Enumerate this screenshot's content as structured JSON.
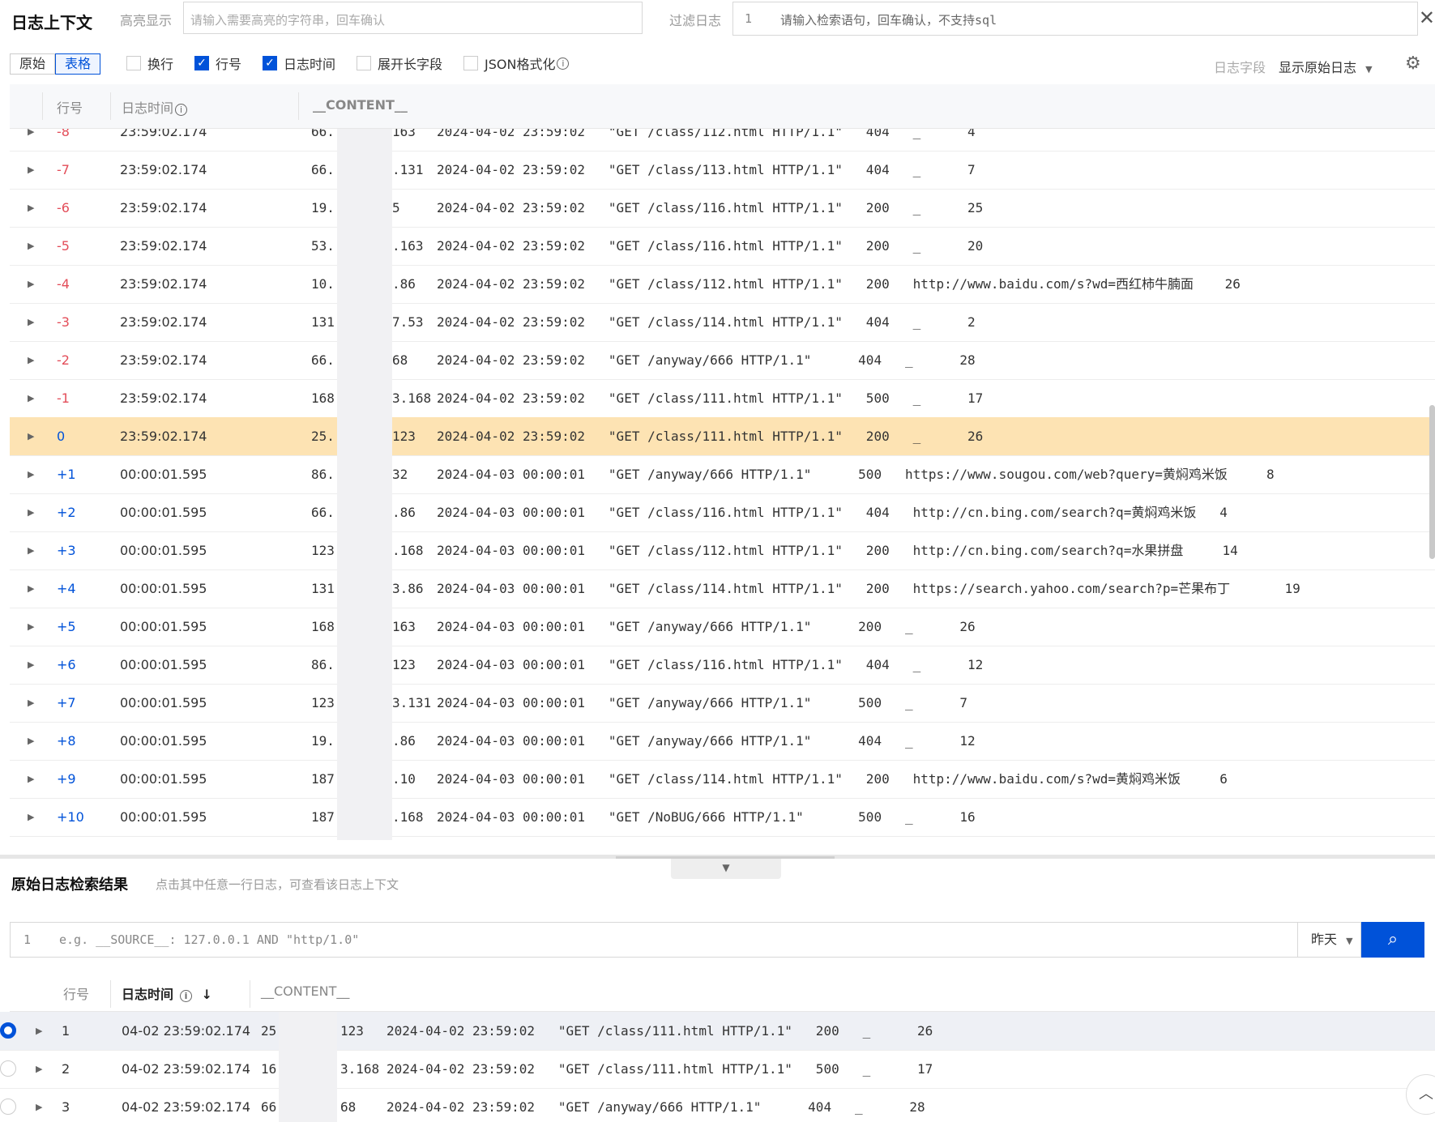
{
  "header": {
    "title": "日志上下文",
    "highlight_label": "高亮显示",
    "highlight_placeholder": "请输入需要高亮的字符串，回车确认",
    "filter_label": "过滤日志",
    "filter_line_no": "1",
    "filter_placeholder": "请输入检索语句，回车确认，不支持sql",
    "close_icon": "close-icon"
  },
  "toolbar": {
    "view_raw": "原始",
    "view_table": "表格",
    "options": [
      {
        "label": "换行",
        "checked": false
      },
      {
        "label": "行号",
        "checked": true
      },
      {
        "label": "日志时间",
        "checked": true
      },
      {
        "label": "展开长字段",
        "checked": false
      },
      {
        "label": "JSON格式化",
        "checked": false
      }
    ],
    "field_label": "日志字段",
    "field_value": "显示原始日志",
    "settings_icon": "gear-icon"
  },
  "context_table": {
    "columns": [
      "行号",
      "日志时间",
      "__CONTENT__"
    ],
    "highlight_color": "#fde3b3",
    "rows": [
      {
        "no": "-8",
        "time": "23:59:02.174",
        "ip_a": "66.",
        "ip_b": "163",
        "content": "2024-04-02 23:59:02   \"GET /class/112.html HTTP/1.1\"   404   _      4"
      },
      {
        "no": "-7",
        "time": "23:59:02.174",
        "ip_a": "66.",
        "ip_b": ".131",
        "content": "2024-04-02 23:59:02   \"GET /class/113.html HTTP/1.1\"   404   _      7"
      },
      {
        "no": "-6",
        "time": "23:59:02.174",
        "ip_a": "19.",
        "ip_b": "5",
        "content": "2024-04-02 23:59:02   \"GET /class/116.html HTTP/1.1\"   200   _      25"
      },
      {
        "no": "-5",
        "time": "23:59:02.174",
        "ip_a": "53.",
        "ip_b": ".163",
        "content": "2024-04-02 23:59:02   \"GET /class/116.html HTTP/1.1\"   200   _      20"
      },
      {
        "no": "-4",
        "time": "23:59:02.174",
        "ip_a": "10.",
        "ip_b": ".86",
        "content": "2024-04-02 23:59:02   \"GET /class/112.html HTTP/1.1\"   200   http://www.baidu.com/s?wd=西红柿牛腩面    26"
      },
      {
        "no": "-3",
        "time": "23:59:02.174",
        "ip_a": "131",
        "ip_b": "7.53",
        "content": "2024-04-02 23:59:02   \"GET /class/114.html HTTP/1.1\"   404   _      2"
      },
      {
        "no": "-2",
        "time": "23:59:02.174",
        "ip_a": "66.",
        "ip_b": "68",
        "content": "2024-04-02 23:59:02   \"GET /anyway/666 HTTP/1.1\"      404   _      28"
      },
      {
        "no": "-1",
        "time": "23:59:02.174",
        "ip_a": "168",
        "ip_b": "3.168",
        "content": "2024-04-02 23:59:02   \"GET /class/111.html HTTP/1.1\"   500   _      17"
      },
      {
        "no": "0",
        "time": "23:59:02.174",
        "ip_a": "25.",
        "ip_b": "123",
        "content": "2024-04-02 23:59:02   \"GET /class/111.html HTTP/1.1\"   200   _      26",
        "highlight": true
      },
      {
        "no": "+1",
        "time": "00:00:01.595",
        "ip_a": "86.",
        "ip_b": "32",
        "content": "2024-04-03 00:00:01   \"GET /anyway/666 HTTP/1.1\"      500   https://www.sougou.com/web?query=黄焖鸡米饭     8"
      },
      {
        "no": "+2",
        "time": "00:00:01.595",
        "ip_a": "66.",
        "ip_b": ".86",
        "content": "2024-04-03 00:00:01   \"GET /class/116.html HTTP/1.1\"   404   http://cn.bing.com/search?q=黄焖鸡米饭   4"
      },
      {
        "no": "+3",
        "time": "00:00:01.595",
        "ip_a": "123",
        "ip_b": ".168",
        "content": "2024-04-03 00:00:01   \"GET /class/112.html HTTP/1.1\"   200   http://cn.bing.com/search?q=水果拼盘     14"
      },
      {
        "no": "+4",
        "time": "00:00:01.595",
        "ip_a": "131",
        "ip_b": "3.86",
        "content": "2024-04-03 00:00:01   \"GET /class/114.html HTTP/1.1\"   200   https://search.yahoo.com/search?p=芒果布丁       19"
      },
      {
        "no": "+5",
        "time": "00:00:01.595",
        "ip_a": "168",
        "ip_b": "163",
        "content": "2024-04-03 00:00:01   \"GET /anyway/666 HTTP/1.1\"      200   _      26"
      },
      {
        "no": "+6",
        "time": "00:00:01.595",
        "ip_a": "86.",
        "ip_b": "123",
        "content": "2024-04-03 00:00:01   \"GET /class/116.html HTTP/1.1\"   404   _      12"
      },
      {
        "no": "+7",
        "time": "00:00:01.595",
        "ip_a": "123",
        "ip_b": "3.131",
        "content": "2024-04-03 00:00:01   \"GET /anyway/666 HTTP/1.1\"      500   _      7"
      },
      {
        "no": "+8",
        "time": "00:00:01.595",
        "ip_a": "19.",
        "ip_b": ".86",
        "content": "2024-04-03 00:00:01   \"GET /anyway/666 HTTP/1.1\"      404   _      12"
      },
      {
        "no": "+9",
        "time": "00:00:01.595",
        "ip_a": "187",
        "ip_b": ".10",
        "content": "2024-04-03 00:00:01   \"GET /class/114.html HTTP/1.1\"   200   http://www.baidu.com/s?wd=黄焖鸡米饭     6"
      },
      {
        "no": "+10",
        "time": "00:00:01.595",
        "ip_a": "187",
        "ip_b": ".168",
        "content": "2024-04-03 00:00:01   \"GET /NoBUG/666 HTTP/1.1\"       500   _      16"
      }
    ]
  },
  "results": {
    "title": "原始日志检索结果",
    "hint": "点击其中任意一行日志，可查看该日志上下文",
    "query_line_no": "1",
    "query_placeholder": "e.g. __SOURCE__: 127.0.0.1 AND \"http/1.0\"",
    "time_range": "昨天",
    "columns": [
      "行号",
      "日志时间",
      "__CONTENT__"
    ],
    "rows": [
      {
        "no": "1",
        "time": "04-02 23:59:02.174",
        "ip_a": "25",
        "ip_b": "123",
        "content": "2024-04-02 23:59:02   \"GET /class/111.html HTTP/1.1\"   200   _      26",
        "selected": true
      },
      {
        "no": "2",
        "time": "04-02 23:59:02.174",
        "ip_a": "16",
        "ip_b": "3.168",
        "content": "2024-04-02 23:59:02   \"GET /class/111.html HTTP/1.1\"   500   _      17"
      },
      {
        "no": "3",
        "time": "04-02 23:59:02.174",
        "ip_a": "66",
        "ip_b": "68",
        "content": "2024-04-02 23:59:02   \"GET /anyway/666 HTTP/1.1\"      404   _      28"
      }
    ]
  }
}
